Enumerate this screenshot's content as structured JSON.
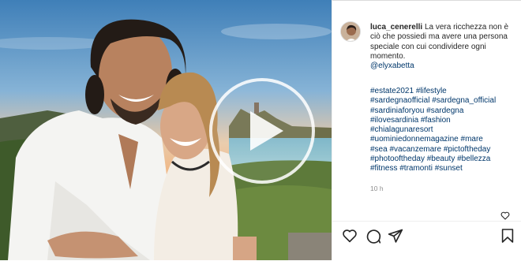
{
  "post": {
    "username": "luca_cenerelli",
    "caption": "La vera ricchezza non è ciò che possiedi ma avere una persona speciale con cui condividere ogni momento.",
    "mention": "@elyxabetta",
    "hashtags": [
      "#estate2021 #lifestyle",
      "#sardegnaofficial #sardegna_official",
      "#sardiniaforyou #sardegna",
      "#ilovesardinia #fashion",
      "#chialagunaresort",
      "#uominiedonnemagazine #mare",
      "#sea #vacanzemare #pictoftheday",
      "#photooftheday #beauty #bellezza",
      "#fitness #tramonti #sunset"
    ],
    "timestamp": "10 h"
  },
  "icons": {
    "play": "play-icon",
    "like": "heart-icon",
    "comment": "comment-icon",
    "share": "paper-plane-icon",
    "save": "bookmark-icon"
  },
  "colors": {
    "link": "#00376b",
    "text": "#262626",
    "muted": "#8e8e8e"
  }
}
